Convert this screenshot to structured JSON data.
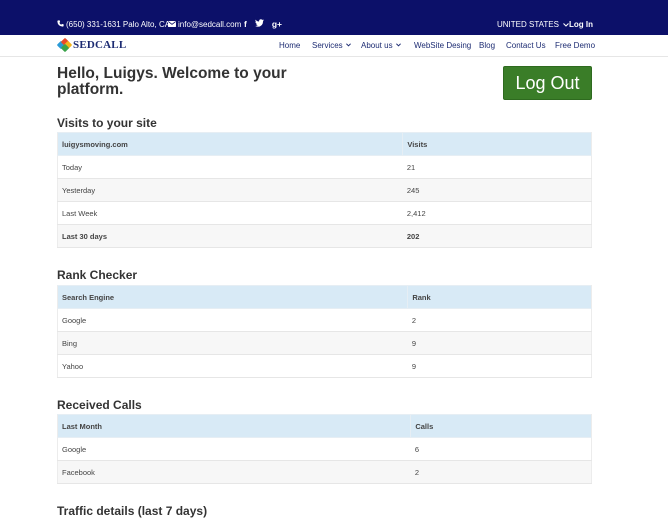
{
  "topbar": {
    "phone": "(650) 331-1631 Palo Alto, CA",
    "email": "info@sedcall.com",
    "social": {
      "facebook": "f",
      "twitter": "t",
      "googleplus": "g+"
    },
    "country": "UNITED STATES",
    "login": "Log In",
    "bg_color": "#0c1069"
  },
  "brand": {
    "name": "SEDCALL"
  },
  "nav": {
    "items": [
      {
        "label": "Home",
        "dropdown": false
      },
      {
        "label": "Services",
        "dropdown": true
      },
      {
        "label": "About us",
        "dropdown": true
      },
      {
        "label": "WebSite Desing",
        "dropdown": false
      },
      {
        "label": "Blog",
        "dropdown": false
      },
      {
        "label": "Contact Us",
        "dropdown": false
      },
      {
        "label": "Free Demo",
        "dropdown": false
      }
    ],
    "color": "#1c2b72"
  },
  "main": {
    "greeting": "Hello, Luigys. Welcome to your platform.",
    "logout_label": "Log Out",
    "logout_color": "#3a7d28"
  },
  "visits": {
    "title": "Visits to your site",
    "headers": [
      "luigysmoving.com",
      "Visits"
    ],
    "rows": [
      [
        "Today",
        "21"
      ],
      [
        "Yesterday",
        "245"
      ],
      [
        "Last Week",
        "2,412"
      ],
      [
        "Last 30 days",
        "202"
      ]
    ]
  },
  "rank": {
    "title": "Rank Checker",
    "headers": [
      "Search Engine",
      "Rank"
    ],
    "rows": [
      [
        "Google",
        "2"
      ],
      [
        "Bing",
        "9"
      ],
      [
        "Yahoo",
        "9"
      ]
    ]
  },
  "calls": {
    "title": "Received Calls",
    "headers": [
      "Last Month",
      "Calls"
    ],
    "rows": [
      [
        "Google",
        "6"
      ],
      [
        "Facebook",
        "2"
      ]
    ]
  },
  "traffic": {
    "title": "Traffic details (last 7 days)"
  },
  "table_header_color": "#d8eaf6"
}
